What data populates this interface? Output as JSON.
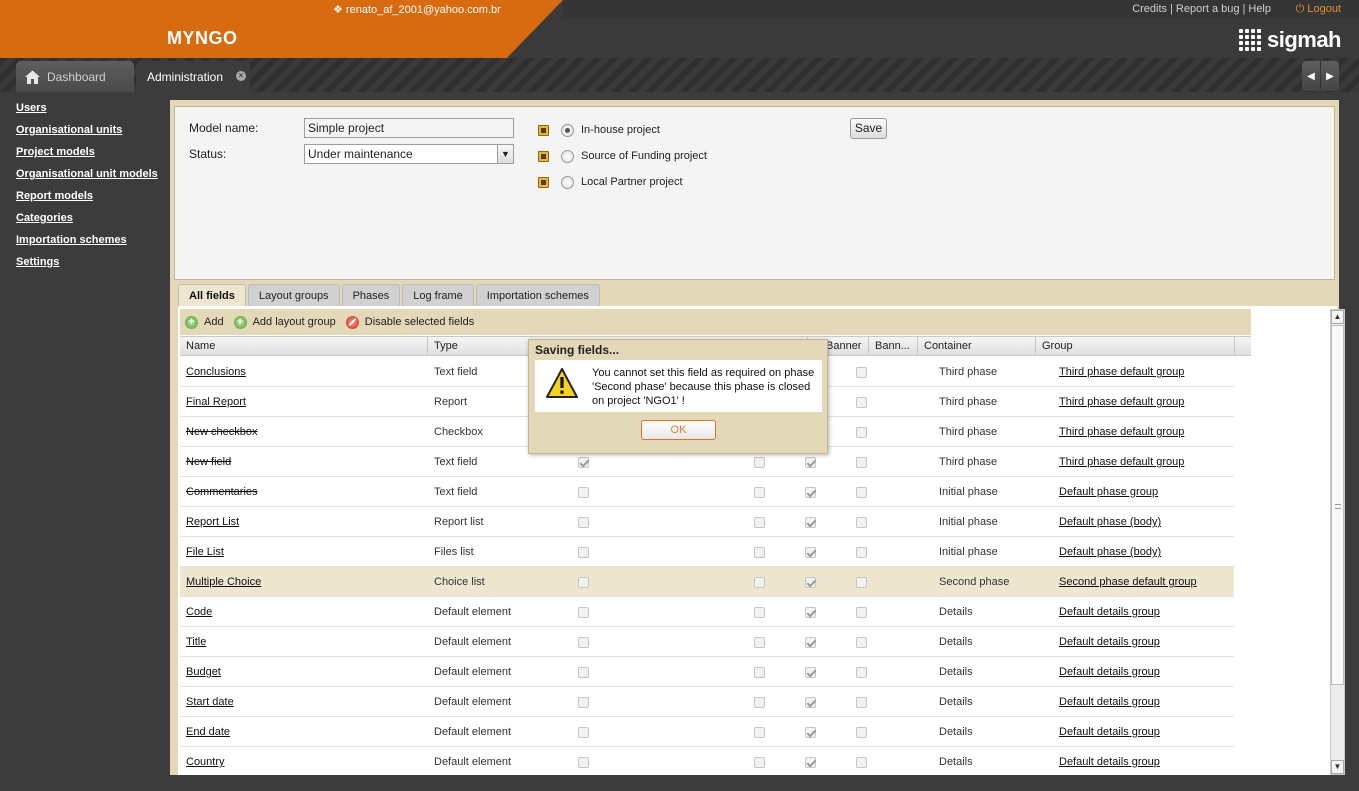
{
  "header": {
    "user_email": "renato_af_2001@yahoo.com.br",
    "app_name": "MYNGO",
    "links": {
      "credits": "Credits",
      "report_bug": "Report a bug",
      "help": "Help",
      "sep": "|"
    },
    "logout": "Logout",
    "logo_text": "sigmah",
    "accent_color": "#d86a10"
  },
  "tabs": {
    "dashboard": "Dashboard",
    "administration": "Administration",
    "close_glyph": "×",
    "nav_left": "◀",
    "nav_right": "▶"
  },
  "sidebar": {
    "items": [
      "Users",
      "Organisational units",
      "Project models",
      "Organisational unit models",
      "Report models",
      "Categories",
      "Importation schemes",
      "Settings"
    ]
  },
  "model": {
    "name_label": "Model name:",
    "name_value": "Simple project",
    "status_label": "Status:",
    "status_value": "Under maintenance",
    "project_types": [
      {
        "label": "In-house project",
        "selected": true
      },
      {
        "label": "Source of Funding project",
        "selected": false
      },
      {
        "label": "Local Partner project",
        "selected": false
      }
    ],
    "save": "Save"
  },
  "subtabs": [
    "All fields",
    "Layout groups",
    "Phases",
    "Log frame",
    "Importation schemes"
  ],
  "toolbar": {
    "add": "Add",
    "add_layout_group": "Add layout group",
    "disable_selected": "Disable selected fields"
  },
  "grid": {
    "columns": {
      "name": "Name",
      "type": "Type",
      "banner": "Banner",
      "banner2": "Bann...",
      "container": "Container",
      "group": "Group"
    },
    "rows": [
      {
        "name": "Conclusions",
        "type": "Text field",
        "container": "Third phase",
        "group": "Third phase default group",
        "disabled": false
      },
      {
        "name": "Final Report",
        "type": "Report",
        "container": "Third phase",
        "group": "Third phase default group",
        "disabled": false
      },
      {
        "name": "New checkbox",
        "type": "Checkbox",
        "container": "Third phase",
        "group": "Third phase default group",
        "disabled": true
      },
      {
        "name": "New field",
        "type": "Text field",
        "container": "Third phase",
        "group": "Third phase default group",
        "disabled": true
      },
      {
        "name": "Commentaries",
        "type": "Text field",
        "container": "Initial phase",
        "group": "Default phase group",
        "disabled": true
      },
      {
        "name": "Report List",
        "type": "Report list",
        "container": "Initial phase",
        "group": "Default phase (body)",
        "disabled": false
      },
      {
        "name": "File List",
        "type": "Files list",
        "container": "Initial phase",
        "group": "Default phase (body)",
        "disabled": false
      },
      {
        "name": "Multiple Choice",
        "type": "Choice list",
        "container": "Second phase",
        "group": "Second phase default group",
        "disabled": false,
        "selected": true
      },
      {
        "name": "Code",
        "type": "Default element",
        "container": "Details",
        "group": "Default details group",
        "disabled": false
      },
      {
        "name": "Title",
        "type": "Default element",
        "container": "Details",
        "group": "Default details group",
        "disabled": false
      },
      {
        "name": "Budget",
        "type": "Default element",
        "container": "Details",
        "group": "Default details group",
        "disabled": false
      },
      {
        "name": "Start date",
        "type": "Default element",
        "container": "Details",
        "group": "Default details group",
        "disabled": false
      },
      {
        "name": "End date",
        "type": "Default element",
        "container": "Details",
        "group": "Default details group",
        "disabled": false
      },
      {
        "name": "Country",
        "type": "Default element",
        "container": "Details",
        "group": "Default details group",
        "disabled": false
      }
    ]
  },
  "dialog": {
    "title": "Saving fields...",
    "message": "You cannot set this field as required on phase 'Second phase' because this phase is closed on project 'NGO1' !",
    "ok": "OK"
  }
}
